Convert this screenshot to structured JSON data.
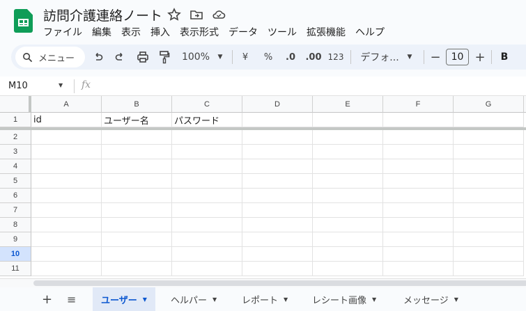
{
  "app": {
    "title": "訪問介護連絡ノート",
    "accent": "#0b57d0",
    "logo_color": "#0f9d58"
  },
  "menu": [
    "ファイル",
    "編集",
    "表示",
    "挿入",
    "表示形式",
    "データ",
    "ツール",
    "拡張機能",
    "ヘルプ"
  ],
  "toolbar": {
    "search": "メニュー",
    "zoom": "100%",
    "currency": "¥",
    "percent": "%",
    "dec_decrease": ".0",
    "dec_increase": ".00",
    "number_format": "123",
    "font": "デフォ...",
    "font_size": "10",
    "minus": "−",
    "plus": "+",
    "bold": "B"
  },
  "namebox": "M10",
  "formula_icon": "fx",
  "columns": [
    "A",
    "B",
    "C",
    "D",
    "E",
    "F",
    "G"
  ],
  "rows": [
    "1",
    "2",
    "3",
    "4",
    "5",
    "6",
    "7",
    "8",
    "9",
    "10",
    "11"
  ],
  "selected_row": "10",
  "cells": {
    "A1": "id",
    "B1": "ユーザー名",
    "C1": "パスワード"
  },
  "sheet_tabs": [
    {
      "label": "ユーザー",
      "active": true
    },
    {
      "label": "ヘルパー"
    },
    {
      "label": "レポート"
    },
    {
      "label": "レシート画像"
    },
    {
      "label": "メッセージ"
    }
  ],
  "add_sheet": "+",
  "all_sheets": "≡"
}
